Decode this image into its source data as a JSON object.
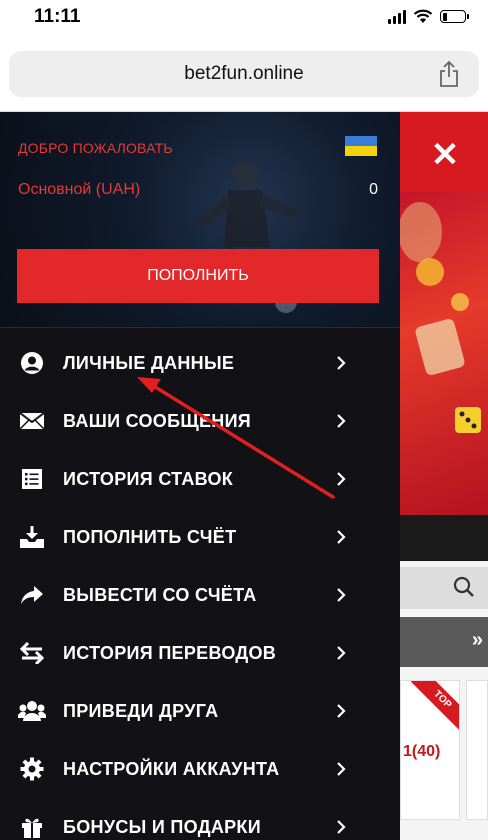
{
  "status_bar": {
    "time": "11:11",
    "battery_level": 0.2
  },
  "browser": {
    "url": "bet2fun.online",
    "share_icon": "share-icon"
  },
  "menu": {
    "welcome": "ДОБРО ПОЖАЛОВАТЬ",
    "flag": "ukraine-flag",
    "account_label": "Основной (UAH)",
    "balance": "0",
    "deposit_button": "ПОПОЛНИТЬ",
    "items": [
      {
        "label": "ЛИЧНЫЕ ДАННЫЕ",
        "icon": "user-icon"
      },
      {
        "label": "ВАШИ СООБЩЕНИЯ",
        "icon": "envelope-icon"
      },
      {
        "label": "ИСТОРИЯ СТАВОК",
        "icon": "list-icon"
      },
      {
        "label": "ПОПОЛНИТЬ СЧЁТ",
        "icon": "download-tray-icon"
      },
      {
        "label": "ВЫВЕСТИ СО СЧЁТА",
        "icon": "share-arrow-icon"
      },
      {
        "label": "ИСТОРИЯ ПЕРЕВОДОВ",
        "icon": "transfer-arrows-icon"
      },
      {
        "label": "ПРИВЕДИ ДРУГА",
        "icon": "users-icon"
      },
      {
        "label": "НАСТРОЙКИ АККАУНТА",
        "icon": "gear-icon"
      },
      {
        "label": "БОНУСЫ И ПОДАРКИ",
        "icon": "gift-icon"
      }
    ]
  },
  "site_background": {
    "close_symbol": "✕",
    "ribbon": "TOP",
    "odds": "1(40)",
    "scroll_more": "»"
  },
  "colors": {
    "accent_red": "#e2282a",
    "menu_bg": "#121216",
    "label_red": "#e53935"
  }
}
